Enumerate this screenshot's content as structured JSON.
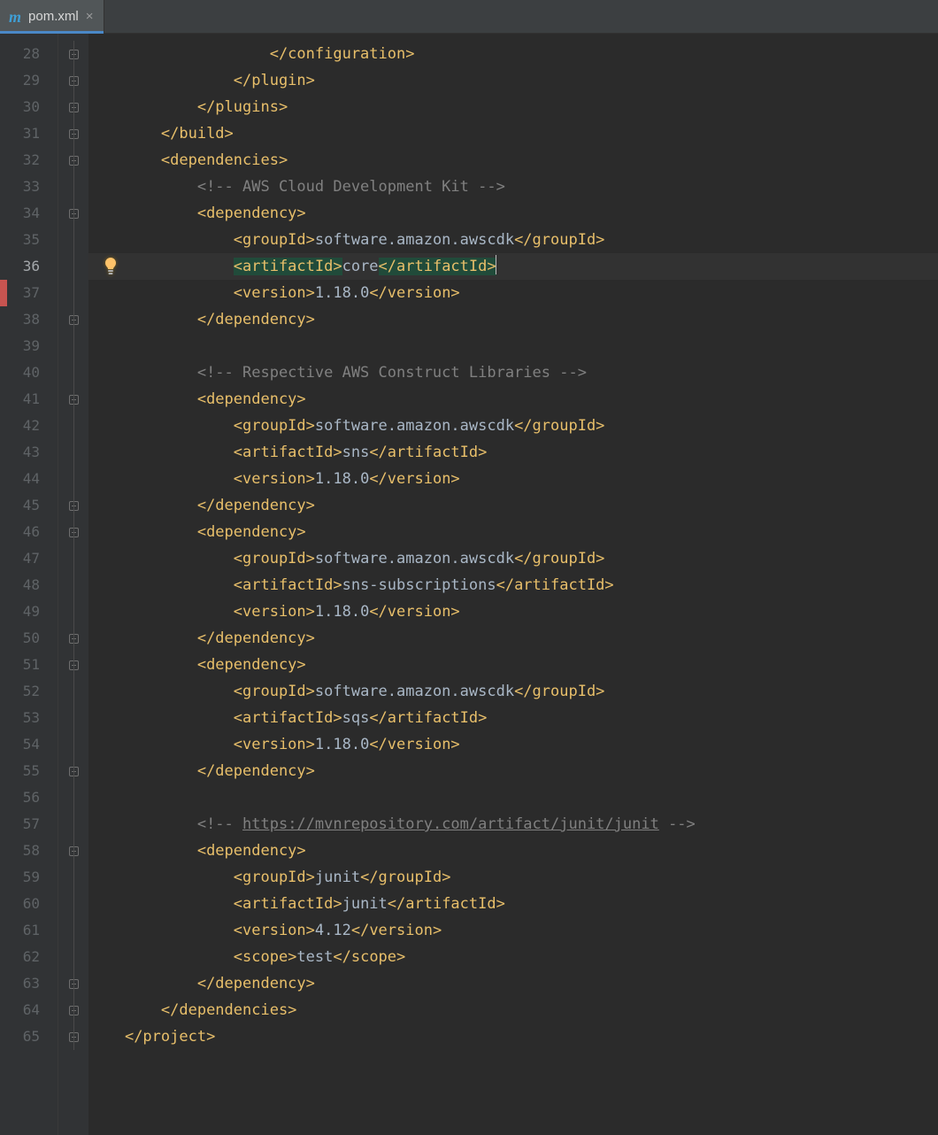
{
  "tab": {
    "filename": "pom.xml",
    "icon_letter": "m"
  },
  "colors": {
    "tag": "#e8bf6a",
    "text": "#a9b7c6",
    "comment": "#808080",
    "gutter_bg": "#313335",
    "editor_bg": "#2b2b2b",
    "active_tab_underline": "#4a88c7",
    "highlight_bg": "#214b3a"
  },
  "active_line": 36,
  "bulb_line": 36,
  "lines": [
    {
      "n": 28,
      "indent": 20,
      "fold": "close",
      "tokens": [
        {
          "c": "tag",
          "t": "</configuration>"
        }
      ]
    },
    {
      "n": 29,
      "indent": 16,
      "fold": "close",
      "tokens": [
        {
          "c": "tag",
          "t": "</plugin>"
        }
      ]
    },
    {
      "n": 30,
      "indent": 12,
      "fold": "close",
      "tokens": [
        {
          "c": "tag",
          "t": "</plugins>"
        }
      ]
    },
    {
      "n": 31,
      "indent": 8,
      "fold": "close",
      "tokens": [
        {
          "c": "tag",
          "t": "</build>"
        }
      ]
    },
    {
      "n": 32,
      "indent": 8,
      "fold": "open",
      "tokens": [
        {
          "c": "tag",
          "t": "<dependencies>"
        }
      ]
    },
    {
      "n": 33,
      "indent": 12,
      "fold": "",
      "tokens": [
        {
          "c": "cmt",
          "t": "<!-- AWS Cloud Development Kit -->"
        }
      ]
    },
    {
      "n": 34,
      "indent": 12,
      "fold": "open",
      "tokens": [
        {
          "c": "tag",
          "t": "<dependency>"
        }
      ]
    },
    {
      "n": 35,
      "indent": 16,
      "fold": "",
      "tokens": [
        {
          "c": "tag",
          "t": "<groupId>"
        },
        {
          "c": "txt",
          "t": "software.amazon.awscdk"
        },
        {
          "c": "tag",
          "t": "</groupId>"
        }
      ]
    },
    {
      "n": 36,
      "indent": 16,
      "fold": "",
      "tokens": [
        {
          "c": "tag hl",
          "t": "<artifactId>"
        },
        {
          "c": "txt",
          "t": "core"
        },
        {
          "c": "tag hl",
          "t": "</artifactId>"
        },
        {
          "c": "caret",
          "t": ""
        }
      ]
    },
    {
      "n": 37,
      "indent": 16,
      "fold": "",
      "tokens": [
        {
          "c": "tag",
          "t": "<version>"
        },
        {
          "c": "txt",
          "t": "1.18.0"
        },
        {
          "c": "tag",
          "t": "</version>"
        }
      ]
    },
    {
      "n": 38,
      "indent": 12,
      "fold": "close",
      "tokens": [
        {
          "c": "tag",
          "t": "</dependency>"
        }
      ]
    },
    {
      "n": 39,
      "indent": 0,
      "fold": "",
      "tokens": []
    },
    {
      "n": 40,
      "indent": 12,
      "fold": "",
      "tokens": [
        {
          "c": "cmt",
          "t": "<!-- Respective AWS Construct Libraries -->"
        }
      ]
    },
    {
      "n": 41,
      "indent": 12,
      "fold": "open",
      "tokens": [
        {
          "c": "tag",
          "t": "<dependency>"
        }
      ]
    },
    {
      "n": 42,
      "indent": 16,
      "fold": "",
      "tokens": [
        {
          "c": "tag",
          "t": "<groupId>"
        },
        {
          "c": "txt",
          "t": "software.amazon.awscdk"
        },
        {
          "c": "tag",
          "t": "</groupId>"
        }
      ]
    },
    {
      "n": 43,
      "indent": 16,
      "fold": "",
      "tokens": [
        {
          "c": "tag",
          "t": "<artifactId>"
        },
        {
          "c": "txt",
          "t": "sns"
        },
        {
          "c": "tag",
          "t": "</artifactId>"
        }
      ]
    },
    {
      "n": 44,
      "indent": 16,
      "fold": "",
      "tokens": [
        {
          "c": "tag",
          "t": "<version>"
        },
        {
          "c": "txt",
          "t": "1.18.0"
        },
        {
          "c": "tag",
          "t": "</version>"
        }
      ]
    },
    {
      "n": 45,
      "indent": 12,
      "fold": "close",
      "tokens": [
        {
          "c": "tag",
          "t": "</dependency>"
        }
      ]
    },
    {
      "n": 46,
      "indent": 12,
      "fold": "open",
      "tokens": [
        {
          "c": "tag",
          "t": "<dependency>"
        }
      ]
    },
    {
      "n": 47,
      "indent": 16,
      "fold": "",
      "tokens": [
        {
          "c": "tag",
          "t": "<groupId>"
        },
        {
          "c": "txt",
          "t": "software.amazon.awscdk"
        },
        {
          "c": "tag",
          "t": "</groupId>"
        }
      ]
    },
    {
      "n": 48,
      "indent": 16,
      "fold": "",
      "tokens": [
        {
          "c": "tag",
          "t": "<artifactId>"
        },
        {
          "c": "txt",
          "t": "sns-subscriptions"
        },
        {
          "c": "tag",
          "t": "</artifactId>"
        }
      ]
    },
    {
      "n": 49,
      "indent": 16,
      "fold": "",
      "tokens": [
        {
          "c": "tag",
          "t": "<version>"
        },
        {
          "c": "txt",
          "t": "1.18.0"
        },
        {
          "c": "tag",
          "t": "</version>"
        }
      ]
    },
    {
      "n": 50,
      "indent": 12,
      "fold": "close",
      "tokens": [
        {
          "c": "tag",
          "t": "</dependency>"
        }
      ]
    },
    {
      "n": 51,
      "indent": 12,
      "fold": "open",
      "tokens": [
        {
          "c": "tag",
          "t": "<dependency>"
        }
      ]
    },
    {
      "n": 52,
      "indent": 16,
      "fold": "",
      "tokens": [
        {
          "c": "tag",
          "t": "<groupId>"
        },
        {
          "c": "txt",
          "t": "software.amazon.awscdk"
        },
        {
          "c": "tag",
          "t": "</groupId>"
        }
      ]
    },
    {
      "n": 53,
      "indent": 16,
      "fold": "",
      "tokens": [
        {
          "c": "tag",
          "t": "<artifactId>"
        },
        {
          "c": "txt",
          "t": "sqs"
        },
        {
          "c": "tag",
          "t": "</artifactId>"
        }
      ]
    },
    {
      "n": 54,
      "indent": 16,
      "fold": "",
      "tokens": [
        {
          "c": "tag",
          "t": "<version>"
        },
        {
          "c": "txt",
          "t": "1.18.0"
        },
        {
          "c": "tag",
          "t": "</version>"
        }
      ]
    },
    {
      "n": 55,
      "indent": 12,
      "fold": "close",
      "tokens": [
        {
          "c": "tag",
          "t": "</dependency>"
        }
      ]
    },
    {
      "n": 56,
      "indent": 0,
      "fold": "",
      "tokens": []
    },
    {
      "n": 57,
      "indent": 12,
      "fold": "",
      "tokens": [
        {
          "c": "cmt",
          "t": "<!-- "
        },
        {
          "c": "link",
          "t": "https://mvnrepository.com/artifact/junit/junit"
        },
        {
          "c": "cmt",
          "t": " -->"
        }
      ]
    },
    {
      "n": 58,
      "indent": 12,
      "fold": "open",
      "tokens": [
        {
          "c": "tag",
          "t": "<dependency>"
        }
      ]
    },
    {
      "n": 59,
      "indent": 16,
      "fold": "",
      "tokens": [
        {
          "c": "tag",
          "t": "<groupId>"
        },
        {
          "c": "txt",
          "t": "junit"
        },
        {
          "c": "tag",
          "t": "</groupId>"
        }
      ]
    },
    {
      "n": 60,
      "indent": 16,
      "fold": "",
      "tokens": [
        {
          "c": "tag",
          "t": "<artifactId>"
        },
        {
          "c": "txt",
          "t": "junit"
        },
        {
          "c": "tag",
          "t": "</artifactId>"
        }
      ]
    },
    {
      "n": 61,
      "indent": 16,
      "fold": "",
      "tokens": [
        {
          "c": "tag",
          "t": "<version>"
        },
        {
          "c": "txt",
          "t": "4.12"
        },
        {
          "c": "tag",
          "t": "</version>"
        }
      ]
    },
    {
      "n": 62,
      "indent": 16,
      "fold": "",
      "tokens": [
        {
          "c": "tag",
          "t": "<scope>"
        },
        {
          "c": "txt",
          "t": "test"
        },
        {
          "c": "tag",
          "t": "</scope>"
        }
      ]
    },
    {
      "n": 63,
      "indent": 12,
      "fold": "close",
      "tokens": [
        {
          "c": "tag",
          "t": "</dependency>"
        }
      ]
    },
    {
      "n": 64,
      "indent": 8,
      "fold": "close",
      "tokens": [
        {
          "c": "tag",
          "t": "</dependencies>"
        }
      ]
    },
    {
      "n": 65,
      "indent": 4,
      "fold": "close",
      "tokens": [
        {
          "c": "tag",
          "t": "</project>"
        }
      ]
    }
  ]
}
